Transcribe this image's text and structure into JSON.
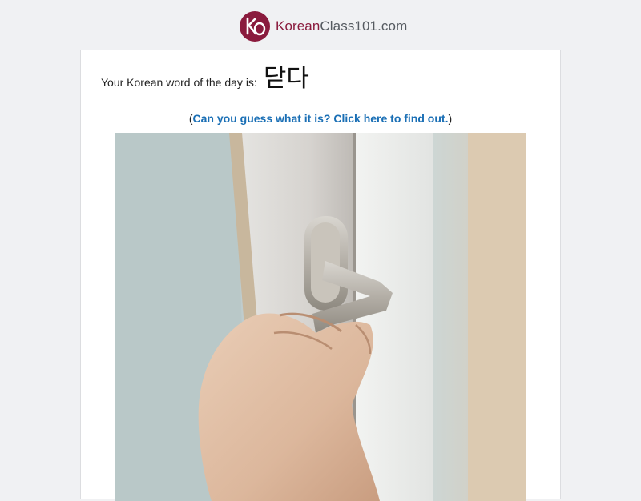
{
  "header": {
    "logo_text_a": "Korean",
    "logo_text_b": "Class101.com",
    "logo_mark_letters": "KO"
  },
  "word_of_day": {
    "label": "Your Korean word of the day is:",
    "word": "닫다"
  },
  "hint": {
    "open_paren": "(",
    "link_text": "Can you guess what it is? Click here to find out.",
    "close_paren": ")"
  },
  "colors": {
    "brand": "#8a1b3d",
    "link": "#1a6fb5",
    "page_bg": "#f0f1f3"
  },
  "photo": {
    "subject": "hand-closing-door-handle"
  }
}
